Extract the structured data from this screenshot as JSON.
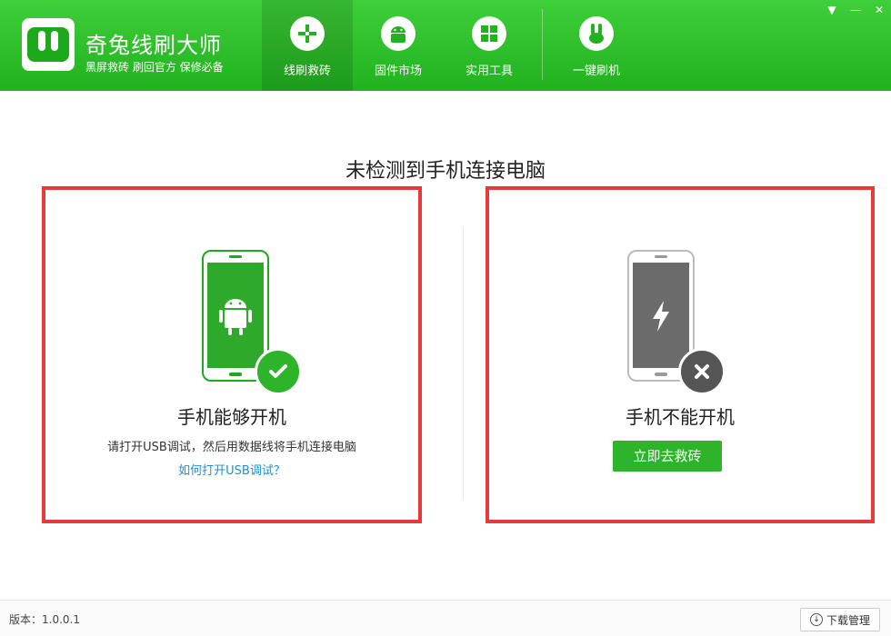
{
  "app": {
    "title": "奇兔线刷大师",
    "subtitle": "黑屏救砖 刷回官方 保修必备"
  },
  "nav": {
    "items": [
      {
        "label": "线刷救砖",
        "icon": "plus-cross-icon",
        "active": true
      },
      {
        "label": "固件市场",
        "icon": "android-icon",
        "active": false
      },
      {
        "label": "实用工具",
        "icon": "grid-icon",
        "active": false
      },
      {
        "label": "一键刷机",
        "icon": "rabbit-icon",
        "active": false
      }
    ]
  },
  "window_controls": {
    "menu": "▼",
    "minimize": "—",
    "close": "✕"
  },
  "main": {
    "title": "未检测到手机连接电脑",
    "left": {
      "title": "手机能够开机",
      "desc": "请打开USB调试，然后用数据线将手机连接电脑",
      "link": "如何打开USB调试？",
      "badge": "check-icon"
    },
    "right": {
      "title": "手机不能开机",
      "button": "立即去救砖",
      "badge": "x-icon"
    }
  },
  "footer": {
    "version": "版本：1.0.0.1",
    "download": "下载管理"
  },
  "colors": {
    "brand_green": "#22b11f",
    "highlight_red": "#e63a3a",
    "link_blue": "#1e8fd6",
    "phone_dark": "#666666"
  }
}
